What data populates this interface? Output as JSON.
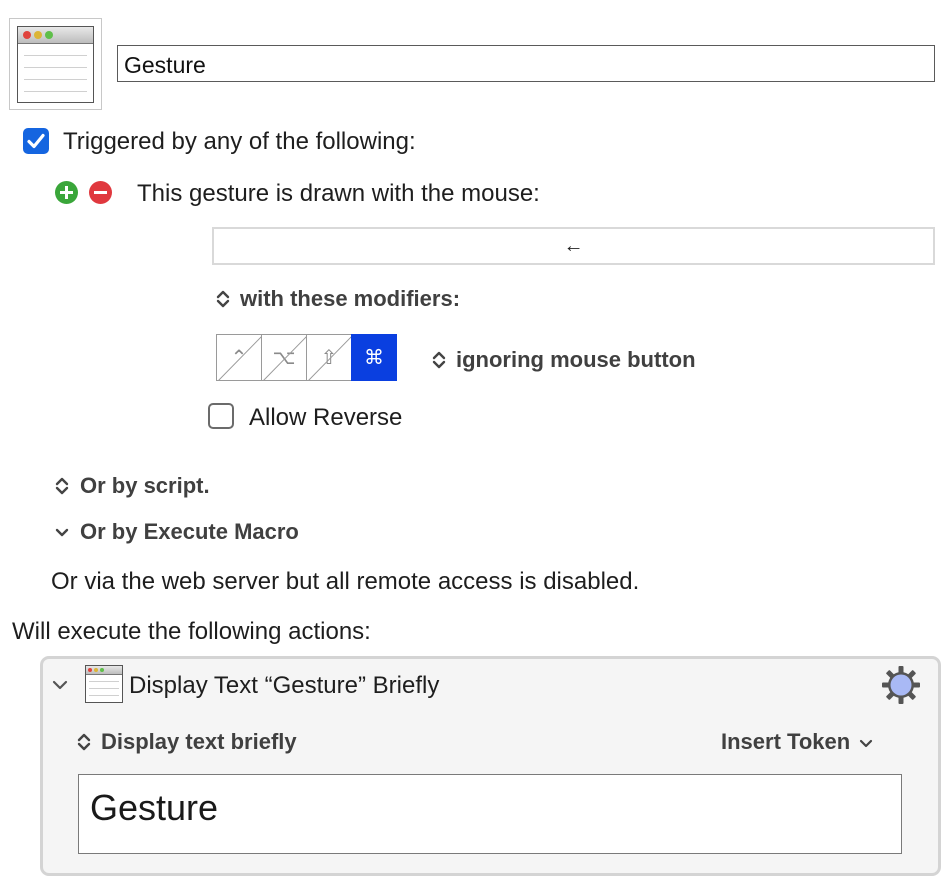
{
  "macro": {
    "name": "Gesture"
  },
  "trigger": {
    "checkbox_label": "Triggered by any of the following:",
    "gesture_label": "This gesture is drawn with the mouse:",
    "gesture_value": "←",
    "modifiers_label": "with these modifiers:",
    "modifiers": [
      {
        "symbol": "⌃",
        "active": false
      },
      {
        "symbol": "⌥",
        "active": false
      },
      {
        "symbol": "⇧",
        "active": false
      },
      {
        "symbol": "⌘",
        "active": true
      }
    ],
    "mouse_button_label": "ignoring mouse button",
    "allow_reverse_label": "Allow Reverse"
  },
  "other_triggers": {
    "script_label": "Or by script.",
    "execute_macro_label": "Or by Execute Macro",
    "web_server_text": "Or via the web server but all remote access is disabled."
  },
  "actions": {
    "heading": "Will execute the following actions:",
    "items": [
      {
        "title": "Display Text “Gesture” Briefly",
        "mode_label": "Display text briefly",
        "insert_token_label": "Insert Token",
        "text": "Gesture"
      }
    ]
  },
  "colors": {
    "accent": "#1565e0",
    "active_modifier": "#0a3fe0",
    "add": "#3aa63a",
    "remove": "#e0383e"
  }
}
